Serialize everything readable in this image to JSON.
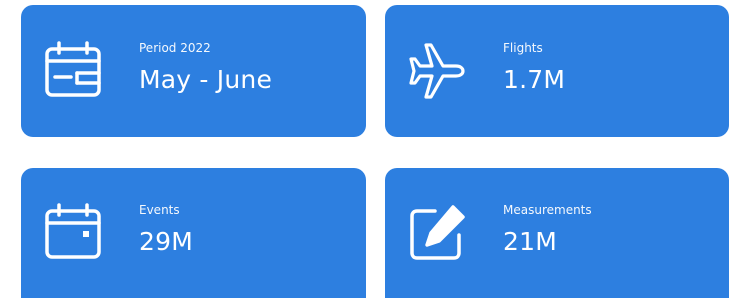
{
  "cards": [
    {
      "label": "Period 2022",
      "value": "May - June",
      "icon": "calendar-period-icon"
    },
    {
      "label": "Flights",
      "value": "1.7M",
      "icon": "airplane-icon"
    },
    {
      "label": "Events",
      "value": "29M",
      "icon": "calendar-event-icon"
    },
    {
      "label": "Measurements",
      "value": "21M",
      "icon": "edit-icon"
    }
  ],
  "colors": {
    "card_background": "#2d7fe0",
    "card_text": "#ffffff",
    "page_background": "#ffffff"
  }
}
